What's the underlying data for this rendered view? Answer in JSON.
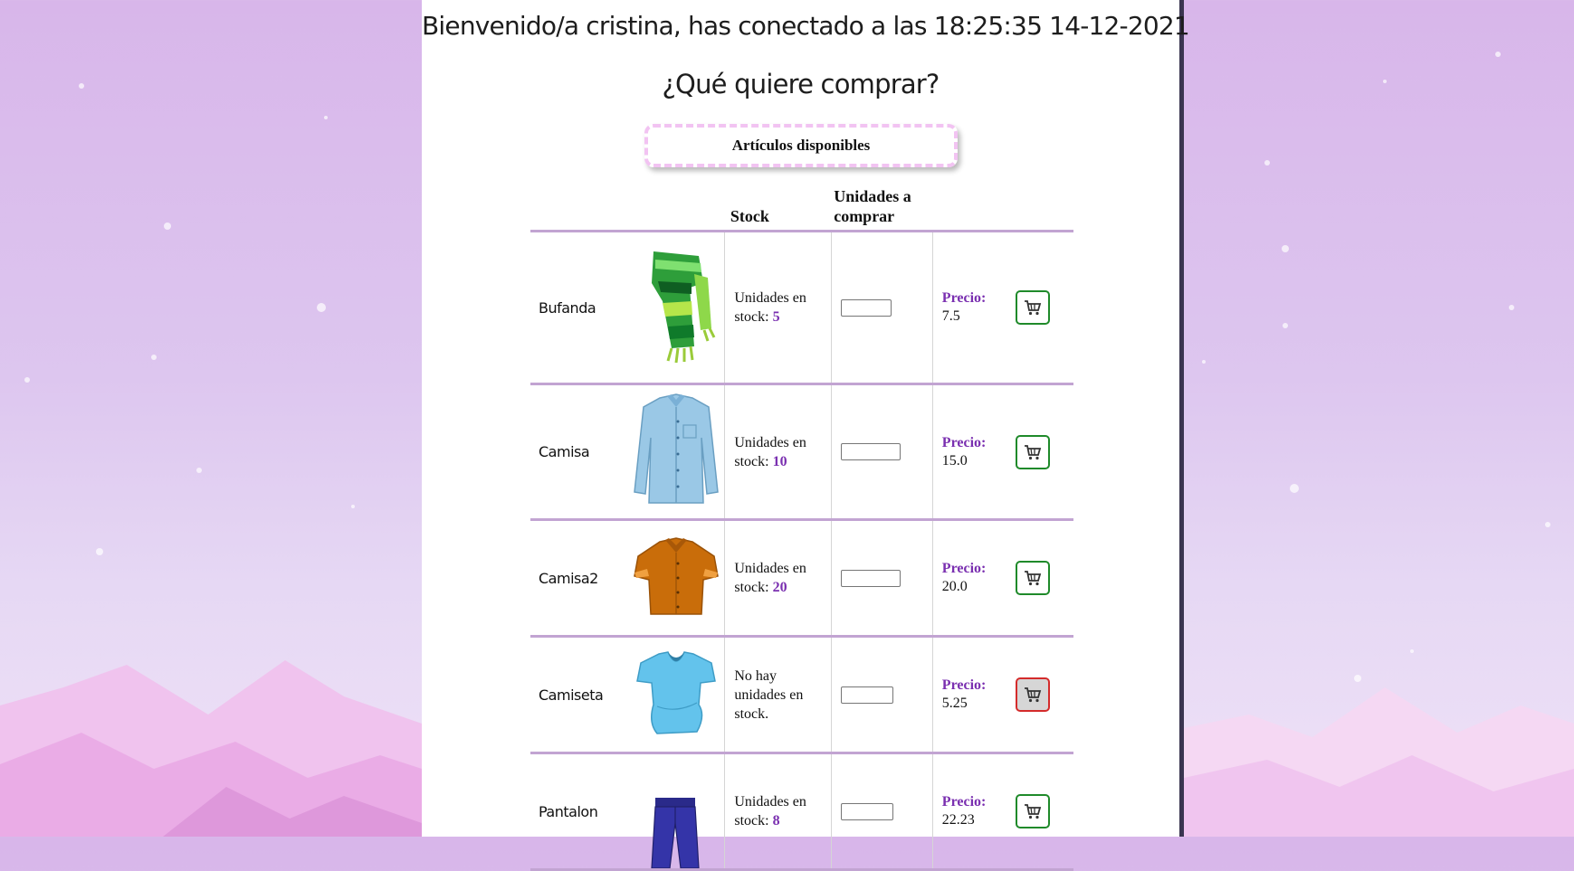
{
  "header": {
    "welcome": "Bienvenido/a cristina, has conectado a las 18:25:35 14-12-2021",
    "question": "¿Qué quiere comprar?",
    "available_label": "Artículos disponibles"
  },
  "table": {
    "col_stock": "Stock",
    "col_units": "Unidades a comprar",
    "stock_prefix": "Unidades en stock: ",
    "price_label": "Precio:",
    "rows": [
      {
        "name": "Bufanda",
        "stock_text": "Unidades en stock: ",
        "stock": "5",
        "price": "7.5",
        "available": true,
        "icon": "scarf-image"
      },
      {
        "name": "Camisa",
        "stock_text": "Unidades en stock: ",
        "stock": "10",
        "price": "15.0",
        "available": true,
        "icon": "shirt-image"
      },
      {
        "name": "Camisa2",
        "stock_text": "Unidades en stock: ",
        "stock": "20",
        "price": "20.0",
        "available": true,
        "icon": "short-sleeve-shirt-image"
      },
      {
        "name": "Camiseta",
        "stock_text": "No hay unidades en stock.",
        "stock": "",
        "price": "5.25",
        "available": false,
        "icon": "tshirt-image"
      },
      {
        "name": "Pantalon",
        "stock_text": "Unidades en stock: ",
        "stock": "8",
        "price": "22.23",
        "available": true,
        "icon": "pants-image"
      }
    ]
  },
  "colors": {
    "accent": "#7a2fb0",
    "row_divider": "#c2a4d2",
    "cart_enabled": "#1f8a2a",
    "cart_disabled": "#d42b2b"
  }
}
